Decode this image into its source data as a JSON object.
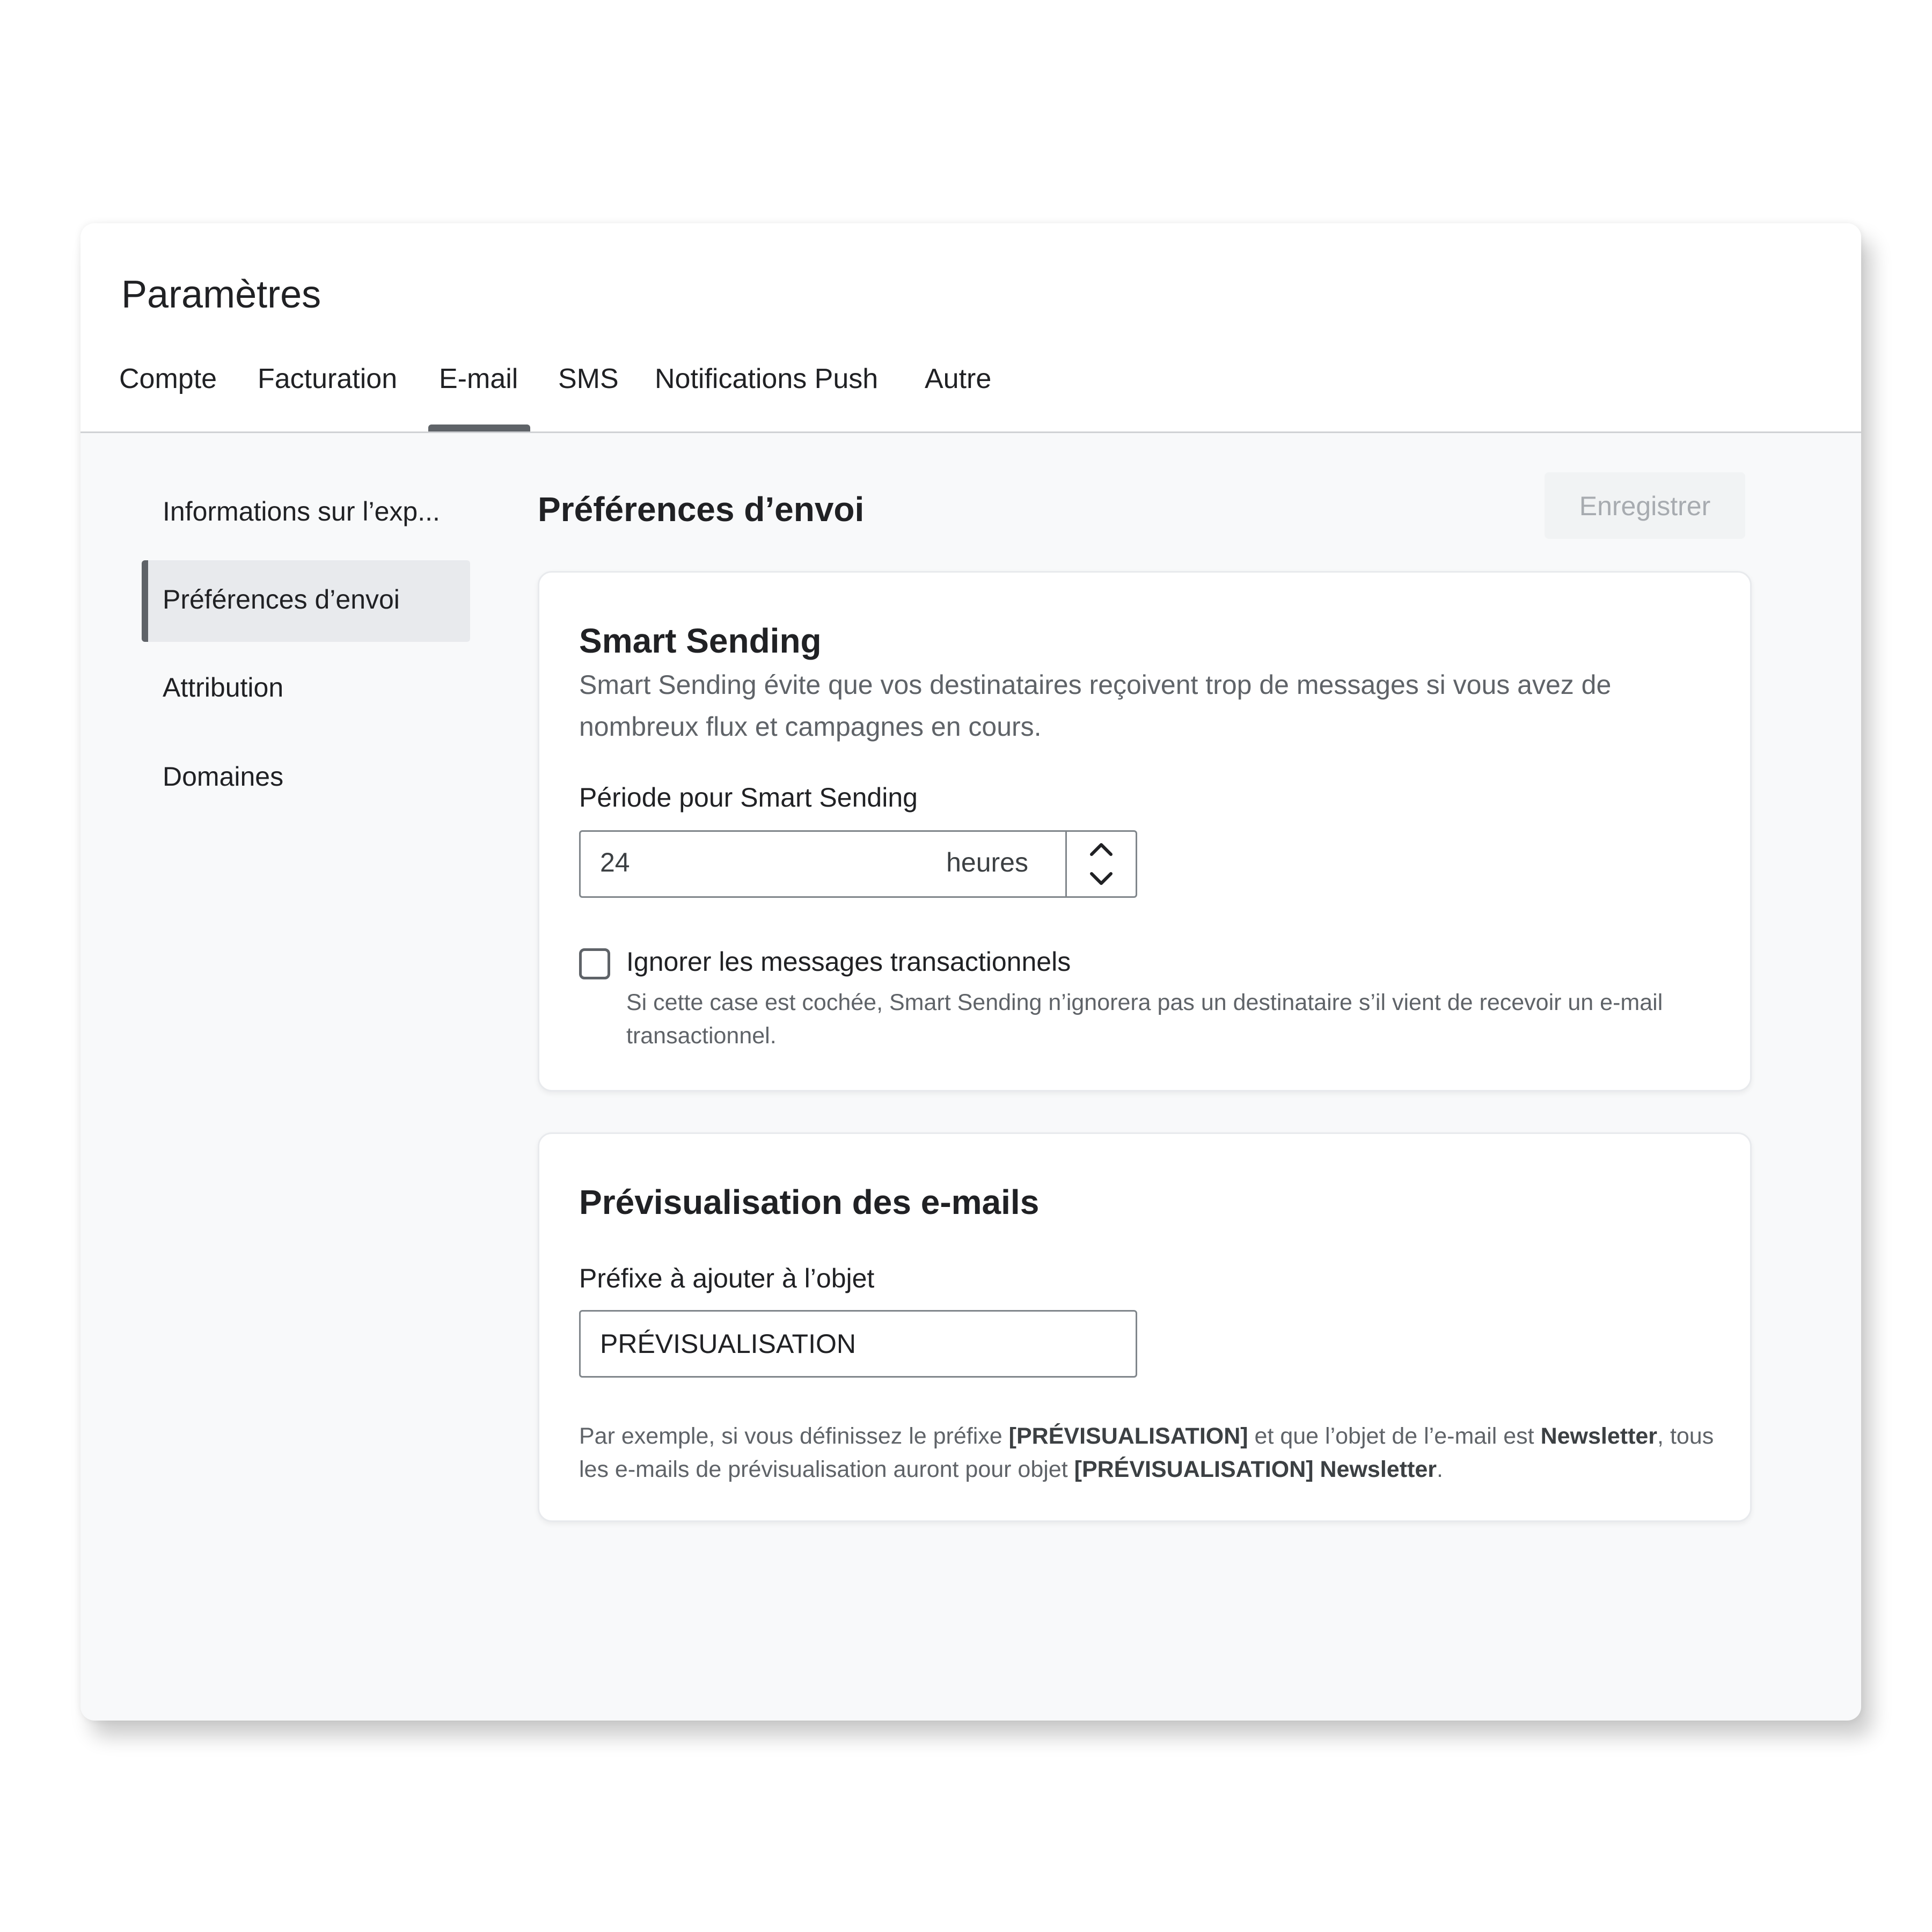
{
  "header": {
    "title": "Paramètres",
    "tabs": [
      {
        "label": "Compte"
      },
      {
        "label": "Facturation"
      },
      {
        "label": "E-mail"
      },
      {
        "label": "SMS"
      },
      {
        "label": "Notifications Push"
      },
      {
        "label": "Autre"
      }
    ],
    "active_tab": "E-mail"
  },
  "sidebar": {
    "items": [
      {
        "label": "Informations sur l’exp..."
      },
      {
        "label": "Préférences d’envoi"
      },
      {
        "label": "Attribution"
      },
      {
        "label": "Domaines"
      }
    ],
    "active_item": "Préférences d’envoi"
  },
  "main": {
    "heading": "Préférences d’envoi",
    "save_label": "Enregistrer",
    "smart_sending": {
      "title": "Smart Sending",
      "description": "Smart Sending évite que vos destinataires reçoivent trop de messages si vous avez de nombreux flux et campagnes en cours.",
      "period_label": "Période pour Smart Sending",
      "period_value": "24",
      "period_unit": "heures",
      "checkbox_label": "Ignorer les messages transactionnels",
      "checkbox_checked": false,
      "checkbox_help": "Si cette case est cochée, Smart Sending n’ignorera pas un destinataire s’il vient de recevoir un e-mail transactionnel."
    },
    "preview": {
      "title": "Prévisualisation des e-mails",
      "prefix_label": "Préfixe à ajouter à l’objet",
      "prefix_value": "PRÉVISUALISATION",
      "example": {
        "t1": "Par exemple, si vous définissez le préfixe ",
        "b1": "[PRÉVISUALISATION]",
        "t2": " et que l’objet de l’e-mail est ",
        "b2": "Newsletter",
        "t3": ", tous les e-mails de prévisualisation auront pour objet ",
        "b3": "[PRÉVISUALISATION] Newsletter",
        "t4": "."
      }
    }
  },
  "colors": {
    "accent_gray": "#5f6368",
    "active_bg": "#e8eaed",
    "content_bg": "#f8f9fa"
  }
}
